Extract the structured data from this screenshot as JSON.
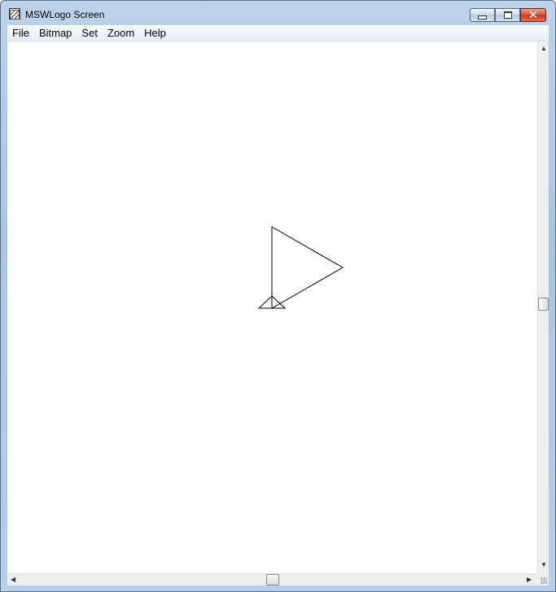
{
  "window": {
    "title": "MSWLogo Screen",
    "icon": "mswlogo-app-icon"
  },
  "caption_buttons": {
    "minimize_icon": "minimize-icon",
    "maximize_icon": "maximize-icon",
    "close_icon": "close-icon",
    "close_color": "#c63a21"
  },
  "menubar": {
    "items": [
      "File",
      "Bitmap",
      "Set",
      "Zoom",
      "Help"
    ]
  },
  "canvas": {
    "background": "#ffffff",
    "stroke_color": "#000000",
    "drawing": "triangle-with-turtle"
  },
  "scrollbars": {
    "up_arrow": "▲",
    "down_arrow": "▼",
    "left_arrow": "◀",
    "right_arrow": "▶"
  }
}
